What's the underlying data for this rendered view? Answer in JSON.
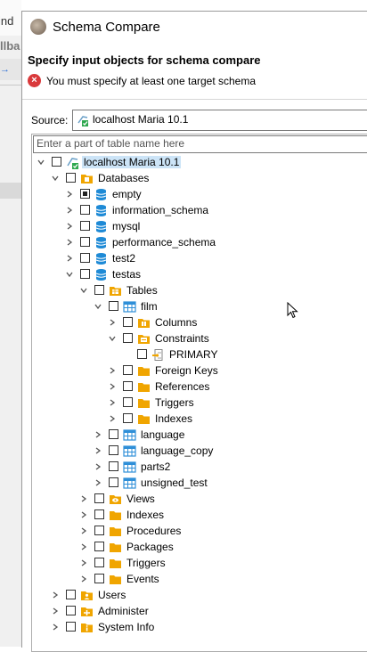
{
  "background": {
    "title_fragment": "ind",
    "toolbar_fragment": "llba"
  },
  "dialog": {
    "title": "Schema Compare",
    "heading": "Specify input objects for schema compare",
    "error": "You must specify at least one target schema",
    "source_label": "Source:",
    "source_value": "localhost Maria 10.1",
    "filter_placeholder": "Enter a part of table name here"
  },
  "tree": [
    {
      "label": "localhost Maria 10.1",
      "level": 0,
      "expand": "open",
      "check": "none",
      "icon": "server-connection",
      "selected": true
    },
    {
      "label": "Databases",
      "level": 1,
      "expand": "open",
      "check": "none",
      "icon": "databases-folder"
    },
    {
      "label": "empty",
      "level": 2,
      "expand": "closed",
      "check": "partial",
      "icon": "database"
    },
    {
      "label": "information_schema",
      "level": 2,
      "expand": "closed",
      "check": "none",
      "icon": "database"
    },
    {
      "label": "mysql",
      "level": 2,
      "expand": "closed",
      "check": "none",
      "icon": "database"
    },
    {
      "label": "performance_schema",
      "level": 2,
      "expand": "closed",
      "check": "none",
      "icon": "database"
    },
    {
      "label": "test2",
      "level": 2,
      "expand": "closed",
      "check": "none",
      "icon": "database"
    },
    {
      "label": "testas",
      "level": 2,
      "expand": "open",
      "check": "none",
      "icon": "database"
    },
    {
      "label": "Tables",
      "level": 3,
      "expand": "open",
      "check": "none",
      "icon": "tables-folder"
    },
    {
      "label": "film",
      "level": 4,
      "expand": "open",
      "check": "none",
      "icon": "table"
    },
    {
      "label": "Columns",
      "level": 5,
      "expand": "closed",
      "check": "none",
      "icon": "columns-folder"
    },
    {
      "label": "Constraints",
      "level": 5,
      "expand": "open",
      "check": "none",
      "icon": "constraints-folder"
    },
    {
      "label": "PRIMARY",
      "level": 6,
      "expand": "none",
      "check": "none",
      "icon": "primary-key"
    },
    {
      "label": "Foreign Keys",
      "level": 5,
      "expand": "closed",
      "check": "none",
      "icon": "folder"
    },
    {
      "label": "References",
      "level": 5,
      "expand": "closed",
      "check": "none",
      "icon": "folder"
    },
    {
      "label": "Triggers",
      "level": 5,
      "expand": "closed",
      "check": "none",
      "icon": "folder"
    },
    {
      "label": "Indexes",
      "level": 5,
      "expand": "closed",
      "check": "none",
      "icon": "folder"
    },
    {
      "label": "language",
      "level": 4,
      "expand": "closed",
      "check": "none",
      "icon": "table"
    },
    {
      "label": "language_copy",
      "level": 4,
      "expand": "closed",
      "check": "none",
      "icon": "table"
    },
    {
      "label": "parts2",
      "level": 4,
      "expand": "closed",
      "check": "none",
      "icon": "table"
    },
    {
      "label": "unsigned_test",
      "level": 4,
      "expand": "closed",
      "check": "none",
      "icon": "table"
    },
    {
      "label": "Views",
      "level": 3,
      "expand": "closed",
      "check": "none",
      "icon": "views-folder"
    },
    {
      "label": "Indexes",
      "level": 3,
      "expand": "closed",
      "check": "none",
      "icon": "folder"
    },
    {
      "label": "Procedures",
      "level": 3,
      "expand": "closed",
      "check": "none",
      "icon": "folder"
    },
    {
      "label": "Packages",
      "level": 3,
      "expand": "closed",
      "check": "none",
      "icon": "folder"
    },
    {
      "label": "Triggers",
      "level": 3,
      "expand": "closed",
      "check": "none",
      "icon": "folder"
    },
    {
      "label": "Events",
      "level": 3,
      "expand": "closed",
      "check": "none",
      "icon": "folder"
    },
    {
      "label": "Users",
      "level": 1,
      "expand": "closed",
      "check": "none",
      "icon": "users-folder"
    },
    {
      "label": "Administer",
      "level": 1,
      "expand": "closed",
      "check": "none",
      "icon": "administer-folder"
    },
    {
      "label": "System Info",
      "level": 1,
      "expand": "closed",
      "check": "none",
      "icon": "system-info-folder"
    }
  ],
  "colors": {
    "folder": "#f0a500",
    "database": "#1e8ad6",
    "table": "#2f8fd8",
    "error": "#d9393b",
    "selection": "#cce4f7"
  }
}
